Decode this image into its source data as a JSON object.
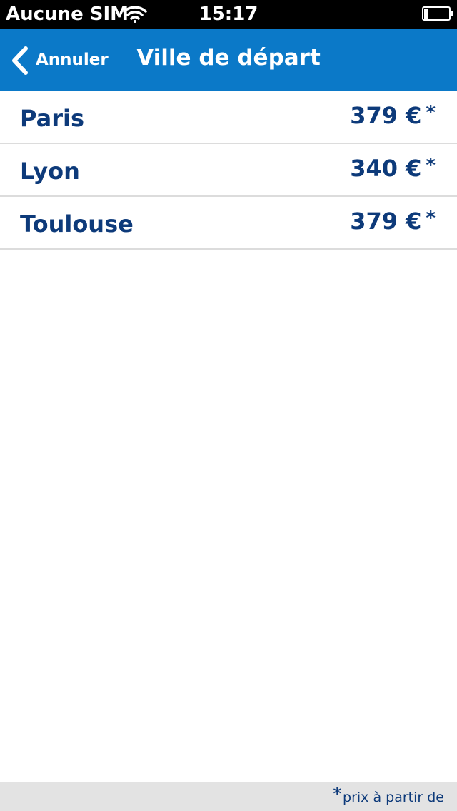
{
  "status_bar": {
    "carrier": "Aucune SIM",
    "time": "15:17",
    "wifi_icon": "wifi-icon",
    "battery_icon": "battery-low-icon"
  },
  "nav": {
    "back_label": "Annuler",
    "back_icon": "chevron-left-icon",
    "title": "Ville de départ",
    "color": "#0b79c8"
  },
  "cities": [
    {
      "name": "Paris",
      "price": "379 €",
      "asterisk": "*"
    },
    {
      "name": "Lyon",
      "price": "340 €",
      "asterisk": "*"
    },
    {
      "name": "Toulouse",
      "price": "379 €",
      "asterisk": "*"
    }
  ],
  "footer": {
    "asterisk": "*",
    "note": "prix à partir de"
  },
  "colors": {
    "text_primary": "#0d3a7a",
    "nav_background": "#0b79c8",
    "footer_background": "#e3e3e3"
  }
}
